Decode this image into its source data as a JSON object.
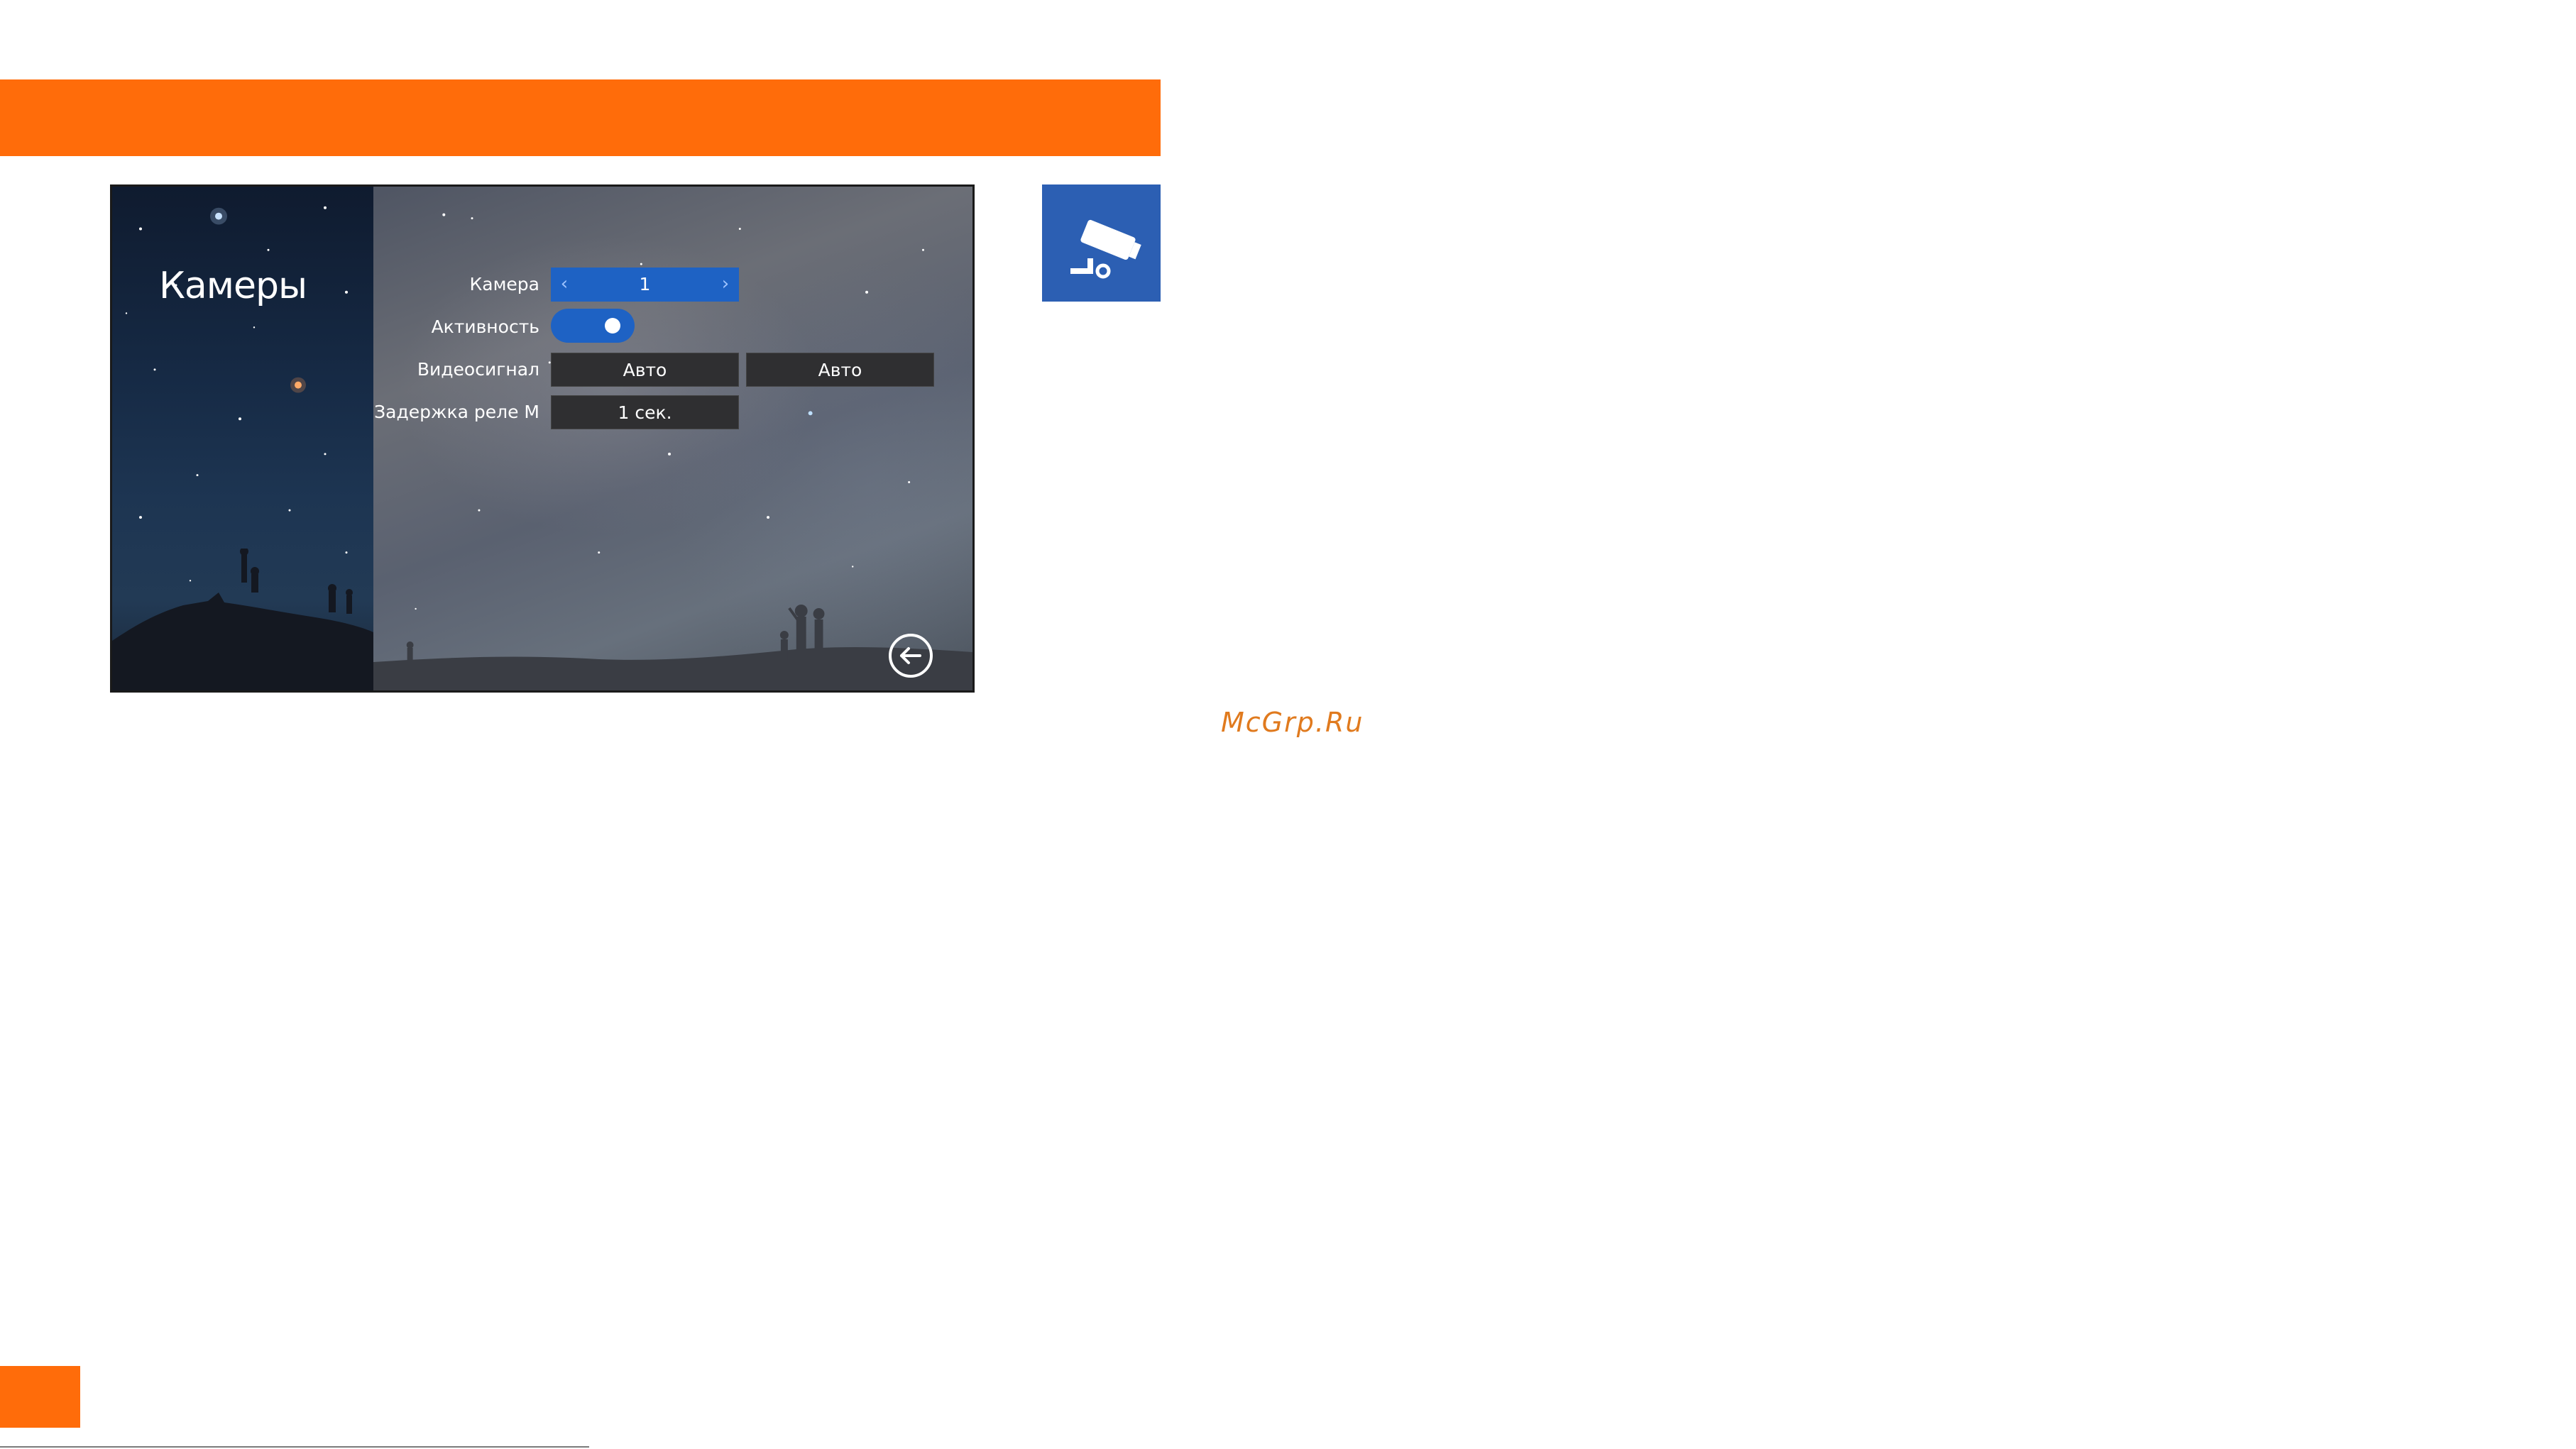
{
  "screen": {
    "title": "Камеры",
    "settings": {
      "camera": {
        "label": "Камера",
        "value": "1",
        "prev_icon": "chevron-left-icon",
        "next_icon": "chevron-right-icon"
      },
      "activity": {
        "label": "Активность",
        "state": "on"
      },
      "video_signal": {
        "label": "Видеосигнал",
        "value_1": "Авто",
        "value_2": "Авто"
      },
      "relay_delay": {
        "label": "Задержка реле M",
        "value": "1 сек."
      }
    },
    "back_icon": "back-arrow-icon"
  },
  "side_tile": {
    "icon": "security-camera-icon",
    "color": "#2c5fb3"
  },
  "watermark": "McGrp.Ru",
  "accent_color": "#ff6c0a"
}
